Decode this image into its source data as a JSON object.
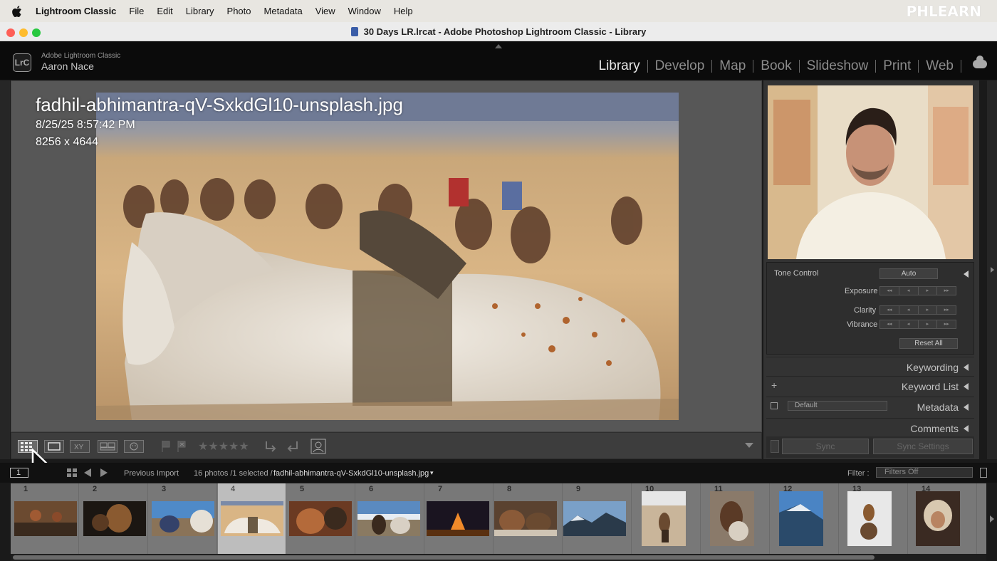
{
  "menubar": {
    "items": [
      "Lightroom Classic",
      "File",
      "Edit",
      "Library",
      "Photo",
      "Metadata",
      "View",
      "Window",
      "Help"
    ],
    "brand": "PHLEARN"
  },
  "window": {
    "title": "30 Days LR.lrcat - Adobe Photoshop Lightroom Classic - Library"
  },
  "identity": {
    "logo": "LrC",
    "product": "Adobe Lightroom Classic",
    "user": "Aaron Nace"
  },
  "modules": [
    "Library",
    "Develop",
    "Map",
    "Book",
    "Slideshow",
    "Print",
    "Web"
  ],
  "active_module": "Library",
  "photo_overlay": {
    "filename": "fadhil-abhimantra-qV-SxkdGl10-unsplash.jpg",
    "date": "8/25/25 8:57:42 PM",
    "dimensions": "8256 x 4644"
  },
  "quick_develop": {
    "tone_control": "Tone Control",
    "auto": "Auto",
    "exposure": "Exposure",
    "clarity": "Clarity",
    "vibrance": "Vibrance",
    "reset_all": "Reset All"
  },
  "panels": {
    "keywording": "Keywording",
    "keyword_list": "Keyword List",
    "metadata": "Metadata",
    "metadata_preset": "Default",
    "comments": "Comments"
  },
  "sync": {
    "sync": "Sync",
    "sync_settings": "Sync Settings"
  },
  "filmstrip_bar": {
    "page_number": "1",
    "source": "Previous Import",
    "count": "16 photos /1 selected /",
    "current_file": "fadhil-abhimantra-qV-SxkdGl10-unsplash.jpg",
    "filter_label": "Filter :",
    "filter_value": "Filters Off"
  },
  "filmstrip": {
    "numbers": [
      "1",
      "2",
      "3",
      "4",
      "5",
      "6",
      "7",
      "8",
      "9",
      "10",
      "11",
      "12",
      "13",
      "14"
    ],
    "selected_index": 4
  },
  "icons": {
    "grid_view": "grid-icon",
    "loupe_view": "loupe-icon",
    "compare_view": "compare-icon",
    "survey_view": "survey-icon",
    "people_view": "people-icon",
    "flag": "flag-icon",
    "reject": "reject-flag-icon",
    "stars": "star-rating-icon",
    "rotate_left": "rotate-left-icon",
    "rotate_right": "rotate-right-icon",
    "crop_overlay": "crop-icon",
    "cloud": "cloud-icon"
  },
  "colors": {
    "menubar_bg": "#e8e6e1",
    "workspace_bg": "#575757",
    "panel_bg": "#333333",
    "filmstrip_bg": "#787878",
    "active_text": "#e8e8e8"
  }
}
